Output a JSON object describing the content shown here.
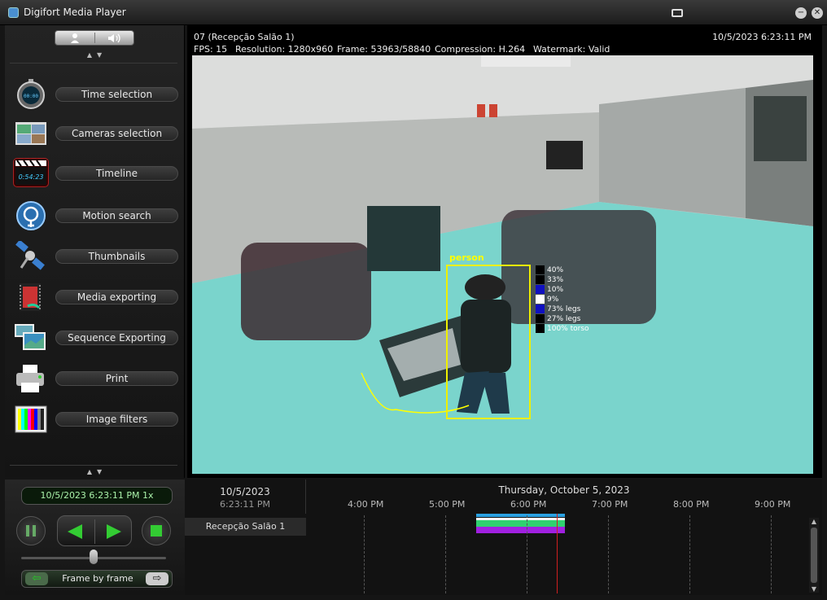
{
  "window": {
    "title": "Digifort Media Player"
  },
  "sidebar": {
    "tools": [
      {
        "label": "Time selection",
        "icon": "stopwatch-icon"
      },
      {
        "label": "Cameras selection",
        "icon": "cameras-icon"
      },
      {
        "label": "Timeline",
        "icon": "clapperboard-icon",
        "icon_text": "0:54:23"
      },
      {
        "label": "Motion search",
        "icon": "motion-search-icon"
      },
      {
        "label": "Thumbnails",
        "icon": "satellite-icon"
      },
      {
        "label": "Media exporting",
        "icon": "film-export-icon"
      },
      {
        "label": "Sequence Exporting",
        "icon": "photo-stack-icon"
      },
      {
        "label": "Print",
        "icon": "printer-icon"
      },
      {
        "label": "Image filters",
        "icon": "color-bars-icon"
      }
    ]
  },
  "video": {
    "camera": "07 (Recepção Salão 1)",
    "datetime": "10/5/2023 6:23:11 PM",
    "fps": "FPS: 15",
    "resolution": "Resolution: 1280x960",
    "frame": "Frame: 53963/58840",
    "compression": "Compression: H.264",
    "watermark": "Watermark: Valid",
    "detection": {
      "label": "person",
      "attributes": [
        {
          "text": "40%",
          "color": "#000000"
        },
        {
          "text": "33%",
          "color": "#000000"
        },
        {
          "text": "10%",
          "color": "#1010c0"
        },
        {
          "text": "9%",
          "color": "#ffffff"
        },
        {
          "text": "73% legs",
          "color": "#1010c0"
        },
        {
          "text": "27% legs",
          "color": "#000000"
        },
        {
          "text": "100% torso",
          "color": "#000000"
        }
      ]
    }
  },
  "playback": {
    "time_display": "10/5/2023 6:23:11 PM 1x",
    "frame_mode": "Frame by frame"
  },
  "timeline": {
    "date": "10/5/2023",
    "time": "6:23:11 PM",
    "day_header": "Thursday, October 5, 2023",
    "hours": [
      "4:00 PM",
      "5:00 PM",
      "6:00 PM",
      "7:00 PM",
      "8:00 PM",
      "9:00 PM"
    ],
    "camera": "Recepção Salão 1",
    "colors": {
      "motion": "#2aa0e0",
      "recording": "#f8f8f8",
      "detection": "#30d070",
      "video": "#a020e0",
      "cursor": "#d02020"
    }
  },
  "colors": {
    "accent_green": "#aaf2aa",
    "bbox": "#f0f000",
    "zone_overlay": "#3ee0d6"
  }
}
